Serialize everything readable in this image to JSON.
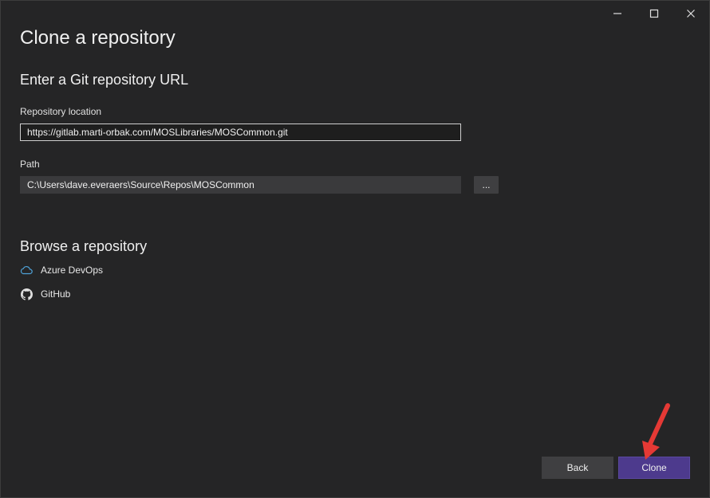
{
  "dialog": {
    "title": "Clone a repository"
  },
  "caption": {
    "minimize_icon": "minimize-icon",
    "maximize_icon": "maximize-icon",
    "close_icon": "close-icon"
  },
  "url_section": {
    "heading": "Enter a Git repository URL",
    "repo_label": "Repository location",
    "repo_value": "https://gitlab.marti-orbak.com/MOSLibraries/MOSCommon.git",
    "path_label": "Path",
    "path_value": "C:\\Users\\dave.everaers\\Source\\Repos\\MOSCommon",
    "browse_label": "..."
  },
  "browse_section": {
    "heading": "Browse a repository",
    "providers": [
      {
        "label": "Azure DevOps",
        "icon": "cloud-icon"
      },
      {
        "label": "GitHub",
        "icon": "github-icon"
      }
    ]
  },
  "footer": {
    "back_label": "Back",
    "clone_label": "Clone"
  },
  "colors": {
    "background": "#252526",
    "accent": "#4d3a8d",
    "annotation": "#e53935"
  }
}
